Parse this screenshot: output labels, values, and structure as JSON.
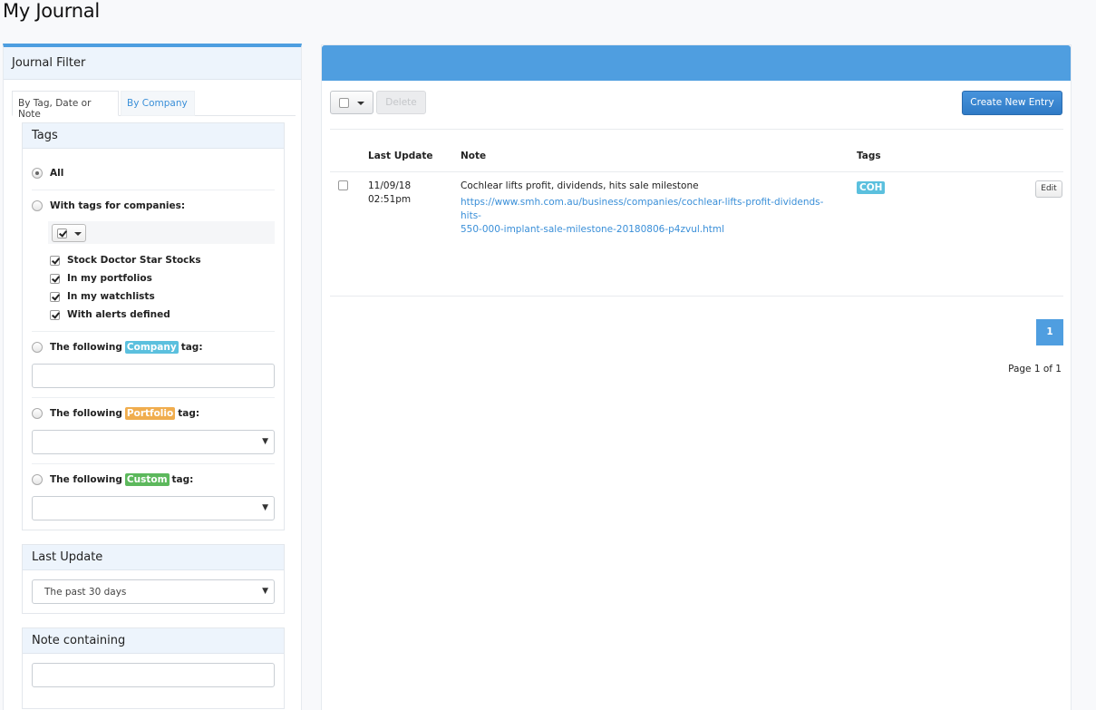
{
  "page": {
    "title": "My Journal"
  },
  "filter": {
    "title": "Journal Filter",
    "tabs": {
      "active": "By Tag, Date or Note",
      "inactive": "By Company"
    },
    "tags": {
      "title": "Tags",
      "all_label": "All",
      "with_tags_label": "With tags for companies:",
      "checks": [
        "Stock Doctor Star Stocks",
        "In my portfolios",
        "In my watchlists",
        "With alerts defined"
      ],
      "following_prefix": "The following",
      "tag_suffix": "tag:",
      "company_tag": "Company",
      "portfolio_tag": "Portfolio",
      "custom_tag": "Custom"
    },
    "last_update": {
      "title": "Last Update",
      "selected": "The past 30 days"
    },
    "note": {
      "title": "Note containing"
    }
  },
  "colors": {
    "company": "#5bc0de",
    "portfolio": "#f0ad4e",
    "custom": "#5cb85c",
    "accent": "#4f9ee0"
  },
  "toolbar": {
    "delete_label": "Delete",
    "create_label": "Create New Entry"
  },
  "table": {
    "headers": {
      "last_update": "Last Update",
      "note": "Note",
      "tags": "Tags"
    },
    "rows": [
      {
        "date": "11/09/18",
        "time": "02:51pm",
        "note": "Cochlear lifts profit, dividends, hits sale milestone",
        "link_line1": "https://www.smh.com.au/business/companies/cochlear-lifts-profit-dividends-hits-",
        "link_line2": "550-000-implant-sale-milestone-20180806-p4zvul.html",
        "tag": "COH",
        "edit_label": "Edit"
      }
    ]
  },
  "pagination": {
    "current": "1",
    "info": "Page 1 of 1"
  }
}
